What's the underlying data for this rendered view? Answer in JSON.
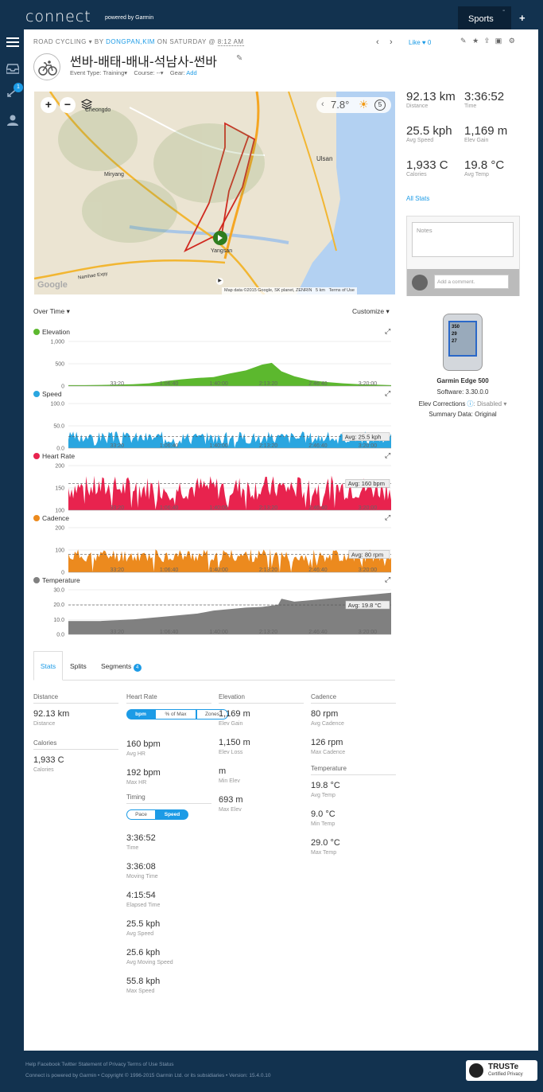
{
  "app": {
    "logo": "connect",
    "logo_sub": "powered by Garmin",
    "sports_tab": "Sports",
    "dash": "-",
    "plus": "+",
    "notif_count": "1"
  },
  "activity": {
    "type": "ROAD CYCLING",
    "by": "BY",
    "user": "DONGPAN,KIM",
    "on": "ON SATURDAY @",
    "time": "8:12 AM",
    "title": "썬바-배태-배내-석남사-썬바",
    "event_label": "Event Type:",
    "event": "Training",
    "course_label": "Course:",
    "course": "--",
    "gear_label": "Gear:",
    "gear_add": "Add",
    "like": "Like",
    "like_count": "0"
  },
  "summary": [
    {
      "value": "92.13 km",
      "label": "Distance"
    },
    {
      "value": "3:36:52",
      "label": "Time"
    },
    {
      "value": "25.5 kph",
      "label": "Avg Speed"
    },
    {
      "value": "1,169 m",
      "label": "Elev Gain"
    },
    {
      "value": "1,933 C",
      "label": "Calories"
    },
    {
      "value": "19.8 °C",
      "label": "Avg Temp"
    }
  ],
  "all_stats": "All Stats",
  "notes": {
    "placeholder": "Notes",
    "comment_placeholder": "Add a comment."
  },
  "device": {
    "name": "Garmin Edge 500",
    "software": "Software: 3.30.0.0",
    "elev_label": "Elev Corrections",
    "elev_value": ": Disabled",
    "summary": "Summary Data: Original",
    "screen": [
      "350",
      "29",
      "27"
    ]
  },
  "map": {
    "temp": "7.8°",
    "labels": [
      "Cheongdo",
      "Miryang",
      "Ulsan",
      "Yangsan",
      "Namhae Expy"
    ],
    "attribution": "Map data ©2015 Google, SK planet, ZENRIN",
    "scale": "5 km",
    "terms": "Terms of Use",
    "google": "Google"
  },
  "charts_header": {
    "over_time": "Over Time",
    "customize": "Customize"
  },
  "chart_data": [
    {
      "type": "area",
      "title": "Elevation",
      "color": "#5cb82e",
      "yticks": [
        "1,000",
        "500",
        "0"
      ],
      "ylim": [
        0,
        1000
      ],
      "xticks": [
        "33:20",
        "1:06:40",
        "1:40:00",
        "2:13:20",
        "2:46:40",
        "3:20:00"
      ],
      "avg_label": "",
      "x": [
        0,
        0.05,
        0.1,
        0.15,
        0.2,
        0.25,
        0.3,
        0.35,
        0.4,
        0.45,
        0.5,
        0.55,
        0.6,
        0.63,
        0.66,
        0.7,
        0.75,
        0.8,
        0.85,
        0.9,
        0.95,
        1
      ],
      "values": [
        20,
        20,
        25,
        30,
        40,
        60,
        110,
        150,
        180,
        200,
        280,
        350,
        480,
        520,
        330,
        220,
        130,
        90,
        60,
        40,
        30,
        20
      ]
    },
    {
      "type": "area",
      "title": "Speed",
      "color": "#2aa6e0",
      "yticks": [
        "100.0",
        "50.0",
        "0.0"
      ],
      "ylim": [
        0,
        100
      ],
      "xticks": [
        "33:20",
        "1:06:40",
        "1:40:00",
        "2:13:20",
        "2:46:40",
        "3:20:00"
      ],
      "avg_label": "Avg: 25.5 kph",
      "avg": 25.5,
      "base": 24,
      "amp": 14,
      "seed": 3
    },
    {
      "type": "area",
      "title": "Heart Rate",
      "color": "#e8234e",
      "yticks": [
        "200",
        "150",
        "100"
      ],
      "ylim": [
        100,
        200
      ],
      "xticks": [
        "33:20",
        "1:06:40",
        "1:40:00",
        "2:13:20",
        "2:46:40",
        "3:20:00"
      ],
      "avg_label": "Avg: 160 bpm",
      "avg": 160,
      "base": 150,
      "amp": 28,
      "seed": 7
    },
    {
      "type": "area",
      "title": "Cadence",
      "color": "#ec8a1e",
      "yticks": [
        "200",
        "100",
        "0"
      ],
      "ylim": [
        0,
        200
      ],
      "xticks": [
        "33:20",
        "1:06:40",
        "1:40:00",
        "2:13:20",
        "2:46:40",
        "3:20:00"
      ],
      "avg_label": "Avg: 80 rpm",
      "avg": 80,
      "base": 75,
      "amp": 30,
      "seed": 11
    },
    {
      "type": "area",
      "title": "Temperature",
      "color": "#808080",
      "yticks": [
        "30.0",
        "20.0",
        "10.0",
        "0.0"
      ],
      "ylim": [
        0,
        30
      ],
      "xticks": [
        "33:20",
        "1:06:40",
        "1:40:00",
        "2:13:20",
        "2:46:40",
        "3:20:00"
      ],
      "avg_label": "Avg: 19.8 °C",
      "avg": 19.8,
      "x": [
        0,
        0.1,
        0.2,
        0.3,
        0.4,
        0.45,
        0.5,
        0.55,
        0.6,
        0.65,
        0.66,
        0.7,
        0.75,
        0.8,
        0.85,
        0.9,
        0.95,
        1
      ],
      "values": [
        9,
        9,
        10,
        12,
        14,
        16,
        17,
        18,
        18.5,
        20,
        24,
        22,
        23,
        24,
        25,
        26,
        27,
        28
      ]
    }
  ],
  "tabs": {
    "stats": "Stats",
    "splits": "Splits",
    "segments": "Segments",
    "segments_count": "4"
  },
  "stats": {
    "distance": {
      "title": "Distance",
      "items": [
        {
          "v": "92.13 km",
          "l": "Distance"
        }
      ]
    },
    "calories": {
      "title": "Calories",
      "items": [
        {
          "v": "1,933 C",
          "l": "Calories"
        }
      ]
    },
    "hr": {
      "title": "Heart Rate",
      "toggle": [
        "bpm",
        "% of Max",
        "Zones"
      ],
      "items": [
        {
          "v": "160 bpm",
          "l": "Avg HR"
        },
        {
          "v": "192 bpm",
          "l": "Max HR"
        }
      ]
    },
    "timing": {
      "title": "Timing",
      "toggle": [
        "Pace",
        "Speed"
      ],
      "items": [
        {
          "v": "3:36:52",
          "l": "Time"
        },
        {
          "v": "3:36:08",
          "l": "Moving Time"
        },
        {
          "v": "4:15:54",
          "l": "Elapsed Time"
        },
        {
          "v": "25.5 kph",
          "l": "Avg Speed"
        },
        {
          "v": "25.6 kph",
          "l": "Avg Moving Speed"
        },
        {
          "v": "55.8 kph",
          "l": "Max Speed"
        }
      ]
    },
    "elev": {
      "title": "Elevation",
      "items": [
        {
          "v": "1,169 m",
          "l": "Elev Gain"
        },
        {
          "v": "1,150 m",
          "l": "Elev Loss"
        },
        {
          "v": "m",
          "l": "Min Elev"
        },
        {
          "v": "693 m",
          "l": "Max Elev"
        }
      ]
    },
    "cadence": {
      "title": "Cadence",
      "items": [
        {
          "v": "80 rpm",
          "l": "Avg Cadence"
        },
        {
          "v": "126 rpm",
          "l": "Max Cadence"
        }
      ]
    },
    "temp": {
      "title": "Temperature",
      "items": [
        {
          "v": "19.8 °C",
          "l": "Avg Temp"
        },
        {
          "v": "9.0 °C",
          "l": "Min Temp"
        },
        {
          "v": "29.0 °C",
          "l": "Max Temp"
        }
      ]
    }
  },
  "footer": {
    "links": "Help Facebook Twitter Statement of Privacy Terms of Use Status",
    "copyright": "Connect is powered by Garmin • Copyright © 1996-2015 Garmin Ltd. or its subsidiaries • Version: 15.4.0.10",
    "truste": "TRUSTe",
    "truste_sub": "Certified Privacy"
  },
  "colors": {
    "accent": "#1c9be6",
    "nav_bg": "#12324f"
  }
}
